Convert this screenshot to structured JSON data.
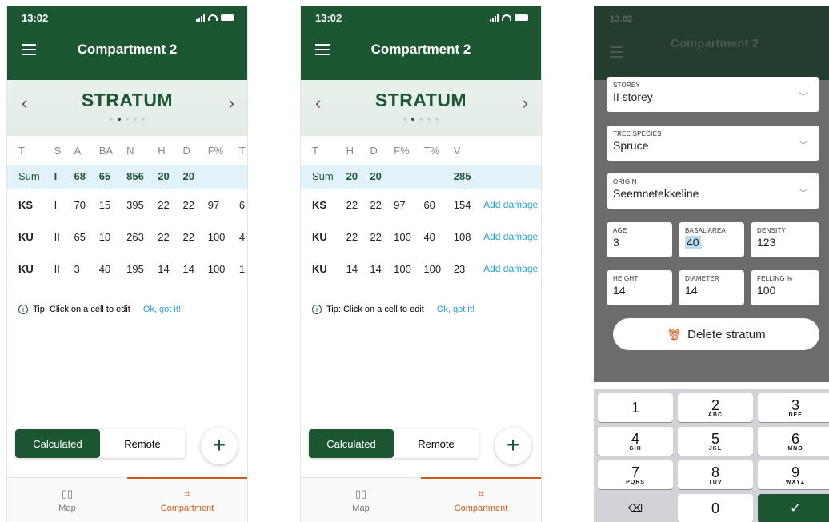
{
  "status": {
    "time": "13:02"
  },
  "header": {
    "title": "Compartment 2"
  },
  "stratum": {
    "label": "STRATUM"
  },
  "screen1": {
    "columns": [
      "T",
      "S",
      "A",
      "BA",
      "N",
      "H",
      "D",
      "F%",
      "T"
    ],
    "sum": [
      "Sum",
      "I",
      "68",
      "65",
      "856",
      "20",
      "20",
      "",
      ""
    ],
    "rows": [
      [
        "KS",
        "I",
        "70",
        "15",
        "395",
        "22",
        "22",
        "97",
        "6"
      ],
      [
        "KU",
        "II",
        "65",
        "10",
        "263",
        "22",
        "22",
        "100",
        "4"
      ],
      [
        "KU",
        "II",
        "3",
        "40",
        "195",
        "14",
        "14",
        "100",
        "1"
      ]
    ]
  },
  "screen2": {
    "columns": [
      "T",
      "H",
      "D",
      "F%",
      "T%",
      "V",
      ""
    ],
    "sum": [
      "Sum",
      "20",
      "20",
      "",
      "",
      "285",
      ""
    ],
    "rows": [
      [
        "KS",
        "22",
        "22",
        "97",
        "60",
        "154",
        "Add damage"
      ],
      [
        "KU",
        "22",
        "22",
        "100",
        "40",
        "108",
        "Add damage"
      ],
      [
        "KU",
        "14",
        "14",
        "100",
        "100",
        "23",
        "Add damage"
      ]
    ]
  },
  "tip": {
    "text": "Tip: Click on a cell to edit",
    "ok": "Ok, got it!"
  },
  "toggle": {
    "calculated": "Calculated",
    "remote": "Remote"
  },
  "tabs": {
    "map": "Map",
    "compartment": "Compartment"
  },
  "form": {
    "storey": {
      "label": "STOREY",
      "value": "II storey"
    },
    "species": {
      "label": "TREE SPECIES",
      "value": "Spruce"
    },
    "origin": {
      "label": "ORIGIN",
      "value": "Seemnetekkeline"
    },
    "age": {
      "label": "AGE",
      "value": "3"
    },
    "basal_area": {
      "label": "BASAL AREA",
      "value": "40"
    },
    "density": {
      "label": "DENSITY",
      "value": "123"
    },
    "height": {
      "label": "HEIGHT",
      "value": "14"
    },
    "diameter": {
      "label": "DIAMETER",
      "value": "14"
    },
    "felling": {
      "label": "FELLING %",
      "value": "100"
    },
    "delete": "Delete stratum"
  },
  "keypad": [
    {
      "n": "1",
      "l": ""
    },
    {
      "n": "2",
      "l": "ABC"
    },
    {
      "n": "3",
      "l": "DEF"
    },
    {
      "n": "4",
      "l": "GHI"
    },
    {
      "n": "5",
      "l": "JKL"
    },
    {
      "n": "6",
      "l": "MNO"
    },
    {
      "n": "7",
      "l": "PQRS"
    },
    {
      "n": "8",
      "l": "TUV"
    },
    {
      "n": "9",
      "l": "WXYZ"
    },
    {
      "n": "",
      "l": ""
    },
    {
      "n": "0",
      "l": ""
    },
    {
      "n": "",
      "l": ""
    }
  ],
  "colors": {
    "primary": "#1c5633",
    "accent": "#d05a1a",
    "link": "#2a9fd4",
    "sum_bg": "#e2f2fa"
  },
  "icons": {
    "menu": "hamburger-icon",
    "add": "plus-icon",
    "map": "map-icon",
    "compartment": "compartment-icon",
    "backspace": "backspace-icon",
    "done": "check-icon",
    "trash": "trash-icon"
  }
}
